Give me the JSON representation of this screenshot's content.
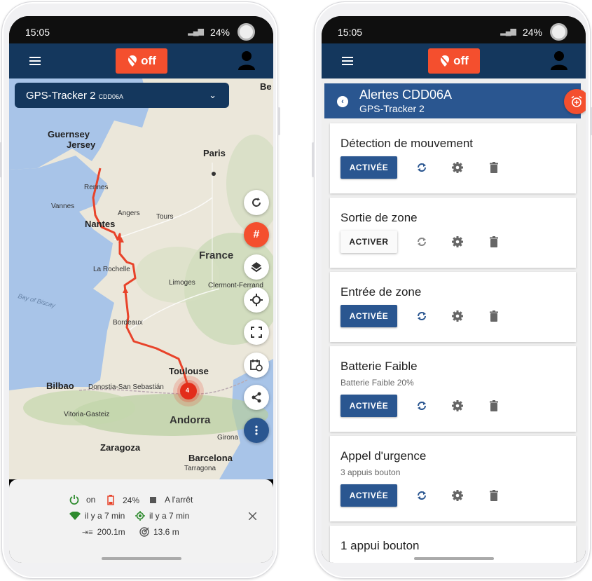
{
  "status_bar": {
    "time": "15:05",
    "battery": "24%"
  },
  "app_bar": {
    "off_label": "off"
  },
  "tracker_selector": {
    "name": "GPS-Tracker 2",
    "id": "CDD06A"
  },
  "map_labels": [
    {
      "text": "Guernsey",
      "cls": "big"
    },
    {
      "text": "Jersey",
      "cls": "big"
    },
    {
      "text": "Paris",
      "cls": "big"
    },
    {
      "text": "Rennes",
      "cls": ""
    },
    {
      "text": "Vannes",
      "cls": ""
    },
    {
      "text": "Angers",
      "cls": ""
    },
    {
      "text": "Tours",
      "cls": ""
    },
    {
      "text": "Nantes",
      "cls": "big"
    },
    {
      "text": "France",
      "cls": "huge"
    },
    {
      "text": "La Rochelle",
      "cls": ""
    },
    {
      "text": "Limoges",
      "cls": ""
    },
    {
      "text": "Clermont-Ferrand",
      "cls": ""
    },
    {
      "text": "Bay of Biscay",
      "cls": "sea"
    },
    {
      "text": "Bordeaux",
      "cls": ""
    },
    {
      "text": "Toulouse",
      "cls": "big"
    },
    {
      "text": "Bilbao",
      "cls": "big"
    },
    {
      "text": "Donostia-San Sebastián",
      "cls": ""
    },
    {
      "text": "Vitoria-Gasteiz",
      "cls": ""
    },
    {
      "text": "Andorra",
      "cls": "huge"
    },
    {
      "text": "Zaragoza",
      "cls": "big"
    },
    {
      "text": "Girona",
      "cls": ""
    },
    {
      "text": "Barcelona",
      "cls": "big"
    },
    {
      "text": "Tarragona",
      "cls": ""
    },
    {
      "text": "Be",
      "cls": "big"
    }
  ],
  "map": {
    "marker_count": "4",
    "hash_label": "#"
  },
  "info_panel": {
    "power": "on",
    "battery": "24%",
    "state": "A l'arrêt",
    "signal_time": "il y a 7 min",
    "gps_time": "il y a 7 min",
    "distance": "200.1m",
    "accuracy": "13.6 m"
  },
  "alerts_header": {
    "title": "Alertes CDD06A",
    "subtitle": "GPS-Tracker 2"
  },
  "alerts": [
    {
      "title": "Détection de mouvement",
      "subtitle": "",
      "button": "ACTIVÉE",
      "active": true
    },
    {
      "title": "Sortie de zone",
      "subtitle": "",
      "button": "ACTIVER",
      "active": false
    },
    {
      "title": "Entrée de zone",
      "subtitle": "",
      "button": "ACTIVÉE",
      "active": true
    },
    {
      "title": "Batterie Faible",
      "subtitle": "Batterie Faible 20%",
      "button": "ACTIVÉE",
      "active": true
    },
    {
      "title": "Appel d'urgence",
      "subtitle": "3 appuis bouton",
      "button": "ACTIVÉE",
      "active": true
    },
    {
      "title": "1 appui bouton",
      "subtitle": "",
      "button": "",
      "active": true
    }
  ],
  "colors": {
    "navy": "#14375d",
    "blue": "#2a5690",
    "orange": "#f44f2e",
    "route": "#e8432a"
  }
}
